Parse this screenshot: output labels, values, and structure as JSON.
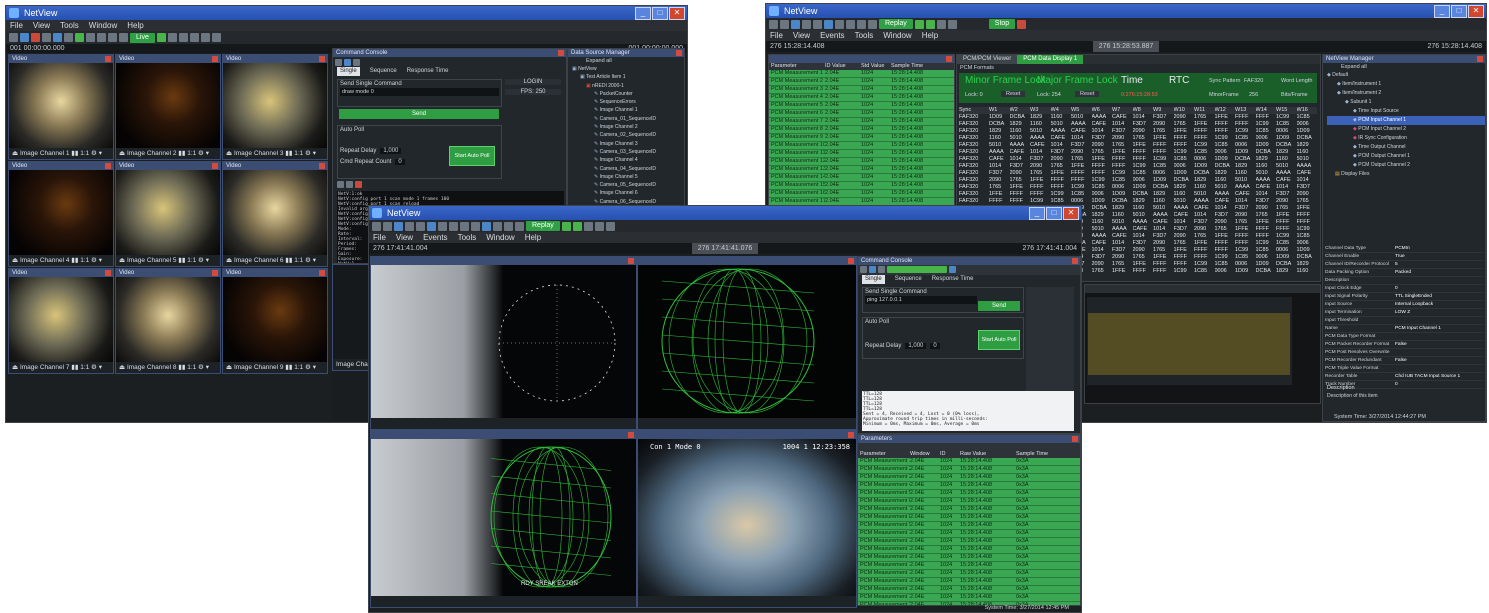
{
  "left_window": {
    "title": "NetView",
    "menu": [
      "File",
      "View",
      "Tools",
      "Window",
      "Help"
    ],
    "live_label": "Live",
    "time_left": "001 00:00:00.000",
    "time_right": "001 00:00:00.000",
    "video_header": "Video",
    "video_channels": [
      "Image Channel 1",
      "Image Channel 2",
      "Image Channel 3",
      "Image Channel 4",
      "Image Channel 5",
      "Image Channel 6",
      "Image Channel 7",
      "Image Channel 8",
      "Image Channel 9"
    ],
    "video_footer_controls": "1:1",
    "image_channel_tab": "Image Channel",
    "command_console": {
      "title": "Command Console",
      "tabs": [
        "Single",
        "Sequence",
        "Response Time"
      ],
      "send_single_label": "Send Single Command",
      "command_value": "draw mode 0",
      "send_button": "Send",
      "auto_poll_label": "Auto Poll",
      "repeat_delay_label": "Repeat Delay",
      "repeat_delay_value": "1,000",
      "cmd_repeat_label": "Cmd Repeat Count",
      "cmd_repeat_value": "0",
      "start_auto_poll": "Start Auto Poll",
      "login_label": "LOGIN",
      "fps_label": "FPS: 250",
      "console_lines": [
        "NetV:1:ok",
        "NetV:config port 1 scan mode 1 frames 100",
        "NetV:config port 1 scan reload",
        "Invalid argument ':reload'",
        "NetV:config port 1 scan mode 0 frames 100",
        "NetV:config port 1 scan program",
        "NetV:config show mode 1",
        "Mode:",
        "Rate:",
        "Interval:",
        "Period:",
        "Frames:",
        "Gain:",
        "Exposure:",
        "NetV:1",
        "Interval:",
        "Period:",
        "Frames:",
        "Gain:",
        "Exposure:"
      ]
    },
    "data_source_manager": {
      "title": "Data Source Manager",
      "expand_all": "Expand all",
      "tree": [
        "NetView",
        "Test Article Item 1",
        "nREDI 2000-1",
        "PacketCounter",
        "SequenceErrors",
        "Image Channel 1",
        "Camera_01_SequenceID",
        "Image Channel 2",
        "Camera_02_SequenceID",
        "Image Channel 3",
        "Camera_03_SequenceID",
        "Image Channel 4",
        "Camera_04_SequenceID",
        "Image Channel 5",
        "Camera_05_SequenceID",
        "Image Channel 6",
        "Camera_06_SequenceID"
      ]
    }
  },
  "right_window": {
    "title": "NetView",
    "menu": [
      "File",
      "View",
      "Events",
      "Tools",
      "Window",
      "Help"
    ],
    "replay_label": "Replay",
    "stop_label": "Stop",
    "time_left": "276 15:28:14.408",
    "time_center": "276 15:28:53.887",
    "time_right": "276 15:28:14.408",
    "tabs": [
      "PCM/PCM Viewer",
      "PCM Data Display 1"
    ],
    "pcm_format_label": "PCM Formats",
    "frame_sync_labels": [
      "Minor Frame Lock",
      "Major Frame Lock",
      "Time",
      "RTC"
    ],
    "sync_pattern_label": "Sync Pattern",
    "sync_pattern_value": "FAF320",
    "word_length_label": "Word Length",
    "minor_frame_label": "MinorFrame",
    "minor_frame_value": "256",
    "bits_frame_label": "Bits/Frame",
    "lock_count_label": "Lock: 0",
    "lock_count_value": "Lock: 254",
    "reset_label": "Reset",
    "time_value": "0:276:15:28:53",
    "table_header": [
      "Sync",
      "W1",
      "W2",
      "W3",
      "W4",
      "W5",
      "W6",
      "W7",
      "W8",
      "W9",
      "W10",
      "W11",
      "W12",
      "W13",
      "W14",
      "W15",
      "W16"
    ],
    "param_header": [
      "Parameter",
      "ID Value",
      "Std Value",
      "Sample Time"
    ],
    "param_rows": 20,
    "param_row_prefix": "PCM Measurement",
    "netview_manager": {
      "title": "NetView Manager",
      "expand_all": "Expand all",
      "tree": [
        "Default",
        "Item/Instrument 1",
        "Item/Instrument 2",
        "Subunit 1",
        "Time Input Source",
        "PCM Input Channel 1",
        "PCM Input Channel 2",
        "IR Sync Configuration",
        "Time Output Channel",
        "PCM Output Channel 1",
        "PCM Output Channel 2",
        "Display Files"
      ],
      "properties": [
        [
          "Channel Data Type",
          "PCMIn"
        ],
        [
          "Channel Enable",
          "True"
        ],
        [
          "Channel ID/Recorder Protocol",
          "5"
        ],
        [
          "Data Packing Option",
          "Packed"
        ],
        [
          "Description",
          ""
        ],
        [
          "Input Clock Edge",
          "0"
        ],
        [
          "Input Signal Polarity",
          "TTL SingleEnded"
        ],
        [
          "Input Source",
          "Internal Loopback"
        ],
        [
          "Input Termination",
          "LOW Z"
        ],
        [
          "Input Threshold",
          ""
        ],
        [
          "Name",
          "PCM Input Channel 1"
        ],
        [
          "PCM Data Type Format",
          ""
        ],
        [
          "PCM Packet Recorder Format",
          "False"
        ],
        [
          "PCM Post Resolves Overwrite",
          ""
        ],
        [
          "PCM Recorder Redundant",
          "False"
        ],
        [
          "PCM Triple Value Format",
          ""
        ],
        [
          "Recorder Table",
          "Chd IUB TACM Input Source 1"
        ],
        [
          "Track Number",
          "0"
        ]
      ],
      "description_label": "Description",
      "description_text": "Description of this item"
    },
    "status_text": "System Time: 3/27/2014 12:44:27 PM"
  },
  "center_window": {
    "title": "NetView",
    "menu": [
      "File",
      "View",
      "Events",
      "Tools",
      "Window",
      "Help"
    ],
    "replay_label": "Replay",
    "time_left": "276 17:41:41.004",
    "time_center": "276 17:41:41.076",
    "time_right": "276 17:41:41.004",
    "video_overlay_1": "RDY SREAK EXTON",
    "video_overlay_2": "Con 1 Mode 0",
    "video_overlay_3": "1004 1 12:23:358",
    "command_console": {
      "title": "Command Console",
      "tabs": [
        "Single",
        "Sequence",
        "Response Time"
      ],
      "send_single_label": "Send Single Command",
      "command_value": "ping 127.0.0.1",
      "send_button": "Send",
      "auto_poll_label": "Auto Poll",
      "repeat_delay_label": "Repeat Delay",
      "repeat_delay_value": "1,000",
      "repeat_count_value": "0",
      "start_auto_poll": "Start Auto Poll",
      "console_lines": [
        "TTL=128",
        "TTL=128",
        "TTL=128",
        "TTL=128",
        "Sent = 4, Received = 4, Lost = 0 (0% loss),",
        "Approximate round trip times in milli-seconds:",
        "Minimum = 0ms, Maximum = 0ms, Average = 0ms"
      ]
    },
    "param_title": "Parameters",
    "param_header": [
      "Parameter",
      "Window",
      "ID",
      "Raw Value",
      "Sample Time"
    ],
    "param_rows": 20,
    "param_row_prefix": "PCM Measurement",
    "status_text": "System Time: 3/27/2014 12:45 PM"
  }
}
